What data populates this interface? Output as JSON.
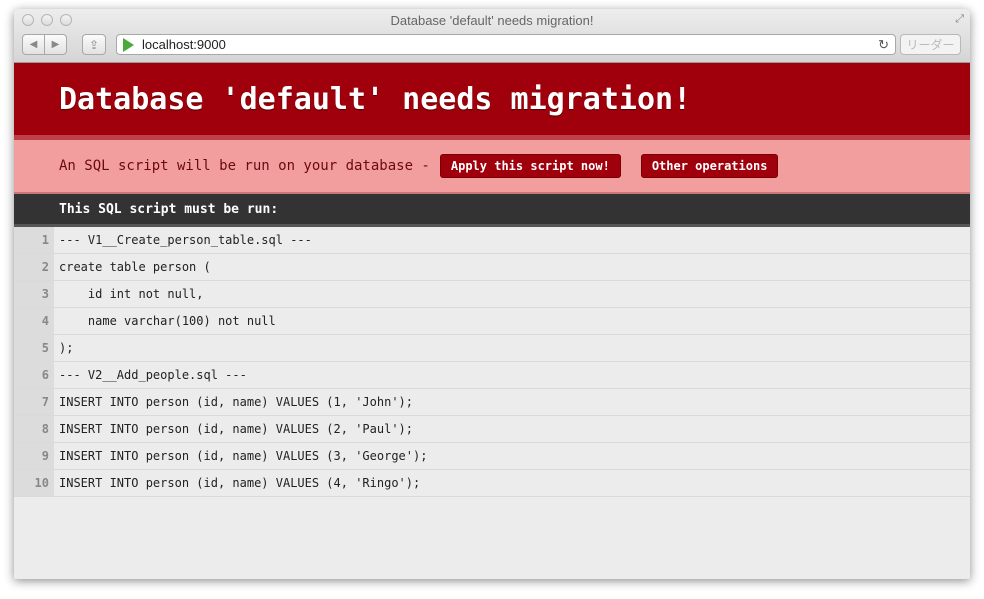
{
  "window": {
    "title": "Database 'default' needs migration!",
    "url": "localhost:9000",
    "reader_label": "リーダー"
  },
  "page": {
    "title": "Database 'default' needs migration!",
    "notice": "An SQL script will be run on your database -",
    "apply_label": "Apply this script now!",
    "other_label": "Other operations",
    "script_heading": "This SQL script must be run:",
    "lines": [
      {
        "n": "1",
        "code": "--- V1__Create_person_table.sql ---"
      },
      {
        "n": "2",
        "code": "create table person ("
      },
      {
        "n": "3",
        "code": "    id int not null,"
      },
      {
        "n": "4",
        "code": "    name varchar(100) not null"
      },
      {
        "n": "5",
        "code": ");"
      },
      {
        "n": "6",
        "code": "--- V2__Add_people.sql ---"
      },
      {
        "n": "7",
        "code": "INSERT INTO person (id, name) VALUES (1, 'John');"
      },
      {
        "n": "8",
        "code": "INSERT INTO person (id, name) VALUES (2, 'Paul');"
      },
      {
        "n": "9",
        "code": "INSERT INTO person (id, name) VALUES (3, 'George');"
      },
      {
        "n": "10",
        "code": "INSERT INTO person (id, name) VALUES (4, 'Ringo');"
      }
    ]
  },
  "colors": {
    "header": "#a0000c",
    "notice": "#f39e9e",
    "dark": "#333333"
  }
}
